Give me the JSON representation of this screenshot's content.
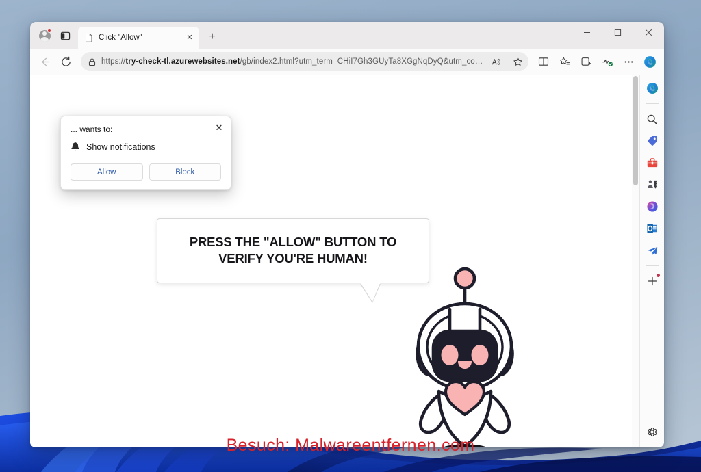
{
  "window": {
    "title": "Click \"Allow\"",
    "controls": {
      "minimize": "–",
      "maximize": "□",
      "close": "✕"
    }
  },
  "tabstrip": {
    "profile_name": "profile-avatar",
    "tab_actions_label": "tab-actions",
    "tab": {
      "title": "Click \"Allow\"",
      "close_label": "✕"
    },
    "new_tab_label": "+"
  },
  "toolbar": {
    "back_label": "Back",
    "refresh_label": "Refresh",
    "url_prefix": "https://",
    "url_host": "try-check-tl.azurewebsites.net",
    "url_path": "/gb/index2.html?utm_term=CHiI7Gh3GUyTa8XGgNqDyQ&utm_content...",
    "url_full": "https://try-check-tl.azurewebsites.net/gb/index2.html?utm_term=CHiI7Gh3GUyTa8XGgNqDyQ&utm_content...",
    "read_aloud_label": "Read aloud",
    "favorite_label": "Add this page to favorites",
    "split_screen_label": "Split screen",
    "favorites_label": "Favorites",
    "collections_label": "Collections",
    "browser_essentials_label": "Browser essentials",
    "settings_more_label": "Settings and more",
    "copilot_label": "Copilot"
  },
  "permission_dialog": {
    "title": "... wants to:",
    "permission_label": "Show notifications",
    "permission_icon": "bell-icon",
    "allow_label": "Allow",
    "block_label": "Block",
    "close_label": "✕",
    "accent_color": "#2f5aa8"
  },
  "page": {
    "bubble_text": "PRESS THE \"ALLOW\" BUTTON TO VERIFY YOU'RE HUMAN!",
    "robot_alt": "friendly-robot-mascot",
    "robot_colors": {
      "outline": "#1d1d2b",
      "cheek": "#f9b3b3",
      "screen": "#1d1d2b",
      "body": "#ffffff"
    }
  },
  "sidebar": {
    "items": [
      {
        "name": "copilot-icon",
        "label": "Copilot"
      },
      {
        "name": "search-icon",
        "label": "Search"
      },
      {
        "name": "shopping-tag-icon",
        "label": "Shopping"
      },
      {
        "name": "tools-icon",
        "label": "Tools"
      },
      {
        "name": "games-icon",
        "label": "Games"
      },
      {
        "name": "microsoft365-icon",
        "label": "Microsoft 365"
      },
      {
        "name": "outlook-icon",
        "label": "Outlook"
      },
      {
        "name": "send-icon",
        "label": "Drop"
      },
      {
        "name": "add-icon",
        "label": "Customize sidebar"
      }
    ],
    "settings_label": "Sidebar settings"
  },
  "watermark": {
    "text": "Besuch: Malwareentfernen.com",
    "color": "#d8222b"
  },
  "desktop": {
    "background_top": "#9db4cc",
    "background_bottom": "#b8c7d6",
    "bloom_color": "#0b39d6"
  }
}
